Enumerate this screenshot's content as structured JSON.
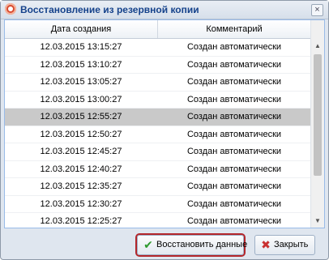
{
  "dialog": {
    "title": "Восстановление из резервной копии",
    "close_glyph": "×"
  },
  "grid": {
    "columns": [
      "Дата создания",
      "Комментарий"
    ],
    "rows": [
      {
        "date": "12.03.2015 13:15:27",
        "comment": "Создан автоматически"
      },
      {
        "date": "12.03.2015 13:10:27",
        "comment": "Создан автоматически"
      },
      {
        "date": "12.03.2015 13:05:27",
        "comment": "Создан автоматически"
      },
      {
        "date": "12.03.2015 13:00:27",
        "comment": "Создан автоматически"
      },
      {
        "date": "12.03.2015 12:55:27",
        "comment": "Создан автоматически"
      },
      {
        "date": "12.03.2015 12:50:27",
        "comment": "Создан автоматически"
      },
      {
        "date": "12.03.2015 12:45:27",
        "comment": "Создан автоматически"
      },
      {
        "date": "12.03.2015 12:40:27",
        "comment": "Создан автоматически"
      },
      {
        "date": "12.03.2015 12:35:27",
        "comment": "Создан автоматически"
      },
      {
        "date": "12.03.2015 12:30:27",
        "comment": "Создан автоматически"
      },
      {
        "date": "12.03.2015 12:25:27",
        "comment": "Создан автоматически"
      }
    ],
    "selected_row": 4
  },
  "scrollbar": {
    "up_glyph": "▲",
    "down_glyph": "▼"
  },
  "buttons": {
    "restore": {
      "label": "Восстановить данные",
      "icon": "checkmark-icon",
      "glyph": "✔"
    },
    "close": {
      "label": "Закрыть",
      "icon": "close-x-icon",
      "glyph": "✖"
    }
  },
  "colors": {
    "selected_row": "#c9c9c9",
    "restore_highlight": "#b3262b",
    "title_text": "#15428b"
  }
}
